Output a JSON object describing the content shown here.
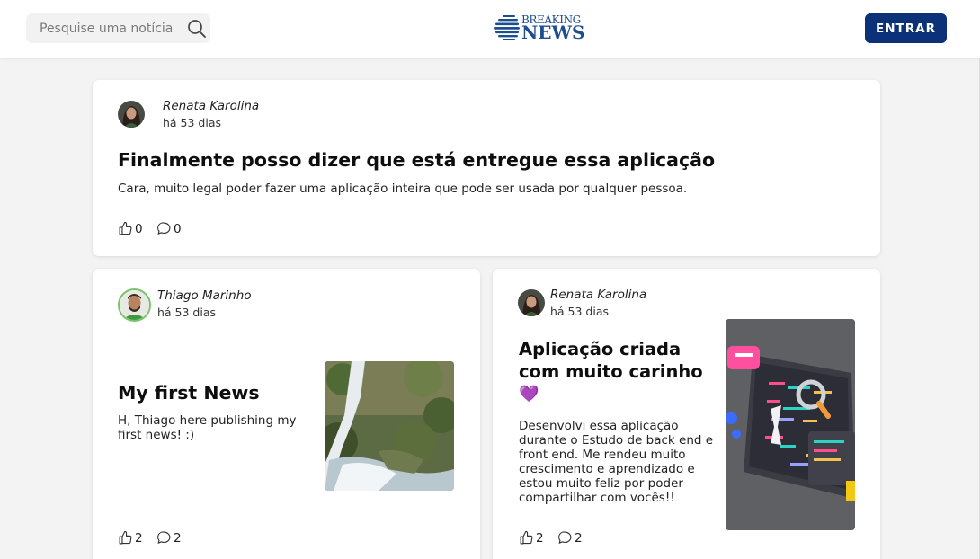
{
  "search": {
    "placeholder": "Pesquise uma notícia",
    "icon": "search-icon"
  },
  "logo": {
    "line1": "BREAKING",
    "line2": "NEWS",
    "color": "#1d4e8f"
  },
  "header": {
    "login_label": "ENTRAR",
    "button_color": "#0b3279"
  },
  "posts": [
    {
      "author": "Renata Karolina",
      "time": "há 53 dias",
      "title": "Finalmente posso dizer que está entregue essa aplicação",
      "text": "Cara, muito legal poder fazer uma aplicação inteira que pode ser usada por qualquer pessoa.",
      "likes": "0",
      "comments": "0"
    },
    {
      "author": "Thiago Marinho",
      "time": "há 53 dias",
      "title": "My first News",
      "text": "H, Thiago here publishing my first news! :)",
      "likes": "2",
      "comments": "2"
    },
    {
      "author": "Renata Karolina",
      "time": "há 53 dias",
      "title_line1": "Aplicação criada",
      "title_line2": "com muito carinho",
      "title_emoji": "💜",
      "text": "Desenvolvi essa aplicação durante o Estudo de back end e front end. Me rendeu muito crescimento e aprendizado e estou muito feliz por poder compartilhar com vocês!!",
      "likes": "2",
      "comments": "2"
    }
  ]
}
